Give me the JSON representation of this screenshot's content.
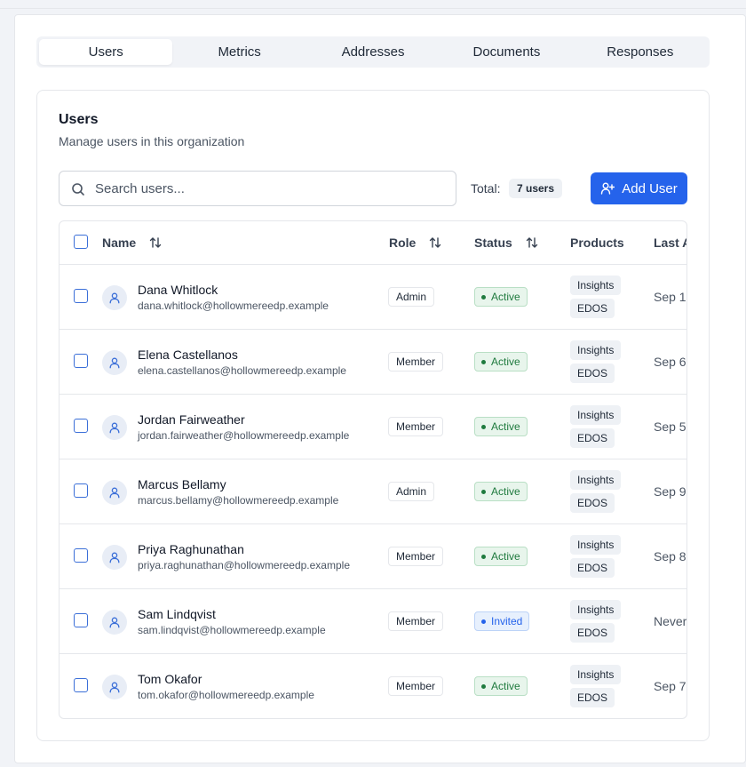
{
  "tabs": [
    "Users",
    "Metrics",
    "Addresses",
    "Documents",
    "Responses"
  ],
  "card": {
    "title": "Users",
    "subtitle": "Manage users in this organization"
  },
  "search": {
    "placeholder": "Search users...",
    "value": ""
  },
  "total": {
    "label": "Total:",
    "badge": "7 users"
  },
  "add_button": {
    "label": "Add User"
  },
  "columns": {
    "name": "Name",
    "role": "Role",
    "status": "Status",
    "products": "Products",
    "last_active": "Last A"
  },
  "rows": [
    {
      "name": "Dana Whitlock",
      "email": "dana.whitlock@hollowmereedp.example",
      "role": "Admin",
      "status": "Active",
      "products": [
        "Insights",
        "EDOS"
      ],
      "last_active": "Sep 1"
    },
    {
      "name": "Elena Castellanos",
      "email": "elena.castellanos@hollowmereedp.example",
      "role": "Member",
      "status": "Active",
      "products": [
        "Insights",
        "EDOS"
      ],
      "last_active": "Sep 6"
    },
    {
      "name": "Jordan Fairweather",
      "email": "jordan.fairweather@hollowmereedp.example",
      "role": "Member",
      "status": "Active",
      "products": [
        "Insights",
        "EDOS"
      ],
      "last_active": "Sep 5"
    },
    {
      "name": "Marcus Bellamy",
      "email": "marcus.bellamy@hollowmereedp.example",
      "role": "Admin",
      "status": "Active",
      "products": [
        "Insights",
        "EDOS"
      ],
      "last_active": "Sep 9"
    },
    {
      "name": "Priya Raghunathan",
      "email": "priya.raghunathan@hollowmereedp.example",
      "role": "Member",
      "status": "Active",
      "products": [
        "Insights",
        "EDOS"
      ],
      "last_active": "Sep 8"
    },
    {
      "name": "Sam Lindqvist",
      "email": "sam.lindqvist@hollowmereedp.example",
      "role": "Member",
      "status": "Invited",
      "products": [
        "Insights",
        "EDOS"
      ],
      "last_active": "Never"
    },
    {
      "name": "Tom Okafor",
      "email": "tom.okafor@hollowmereedp.example",
      "role": "Member",
      "status": "Active",
      "products": [
        "Insights",
        "EDOS"
      ],
      "last_active": "Sep 7"
    }
  ],
  "colors": {
    "primary": "#2563eb",
    "active": "#1f7a3e",
    "invited": "#2563eb"
  },
  "icons": {
    "search": "search-icon",
    "add_user": "user-plus-icon",
    "sort": "sort-icon",
    "avatar": "user-icon"
  }
}
